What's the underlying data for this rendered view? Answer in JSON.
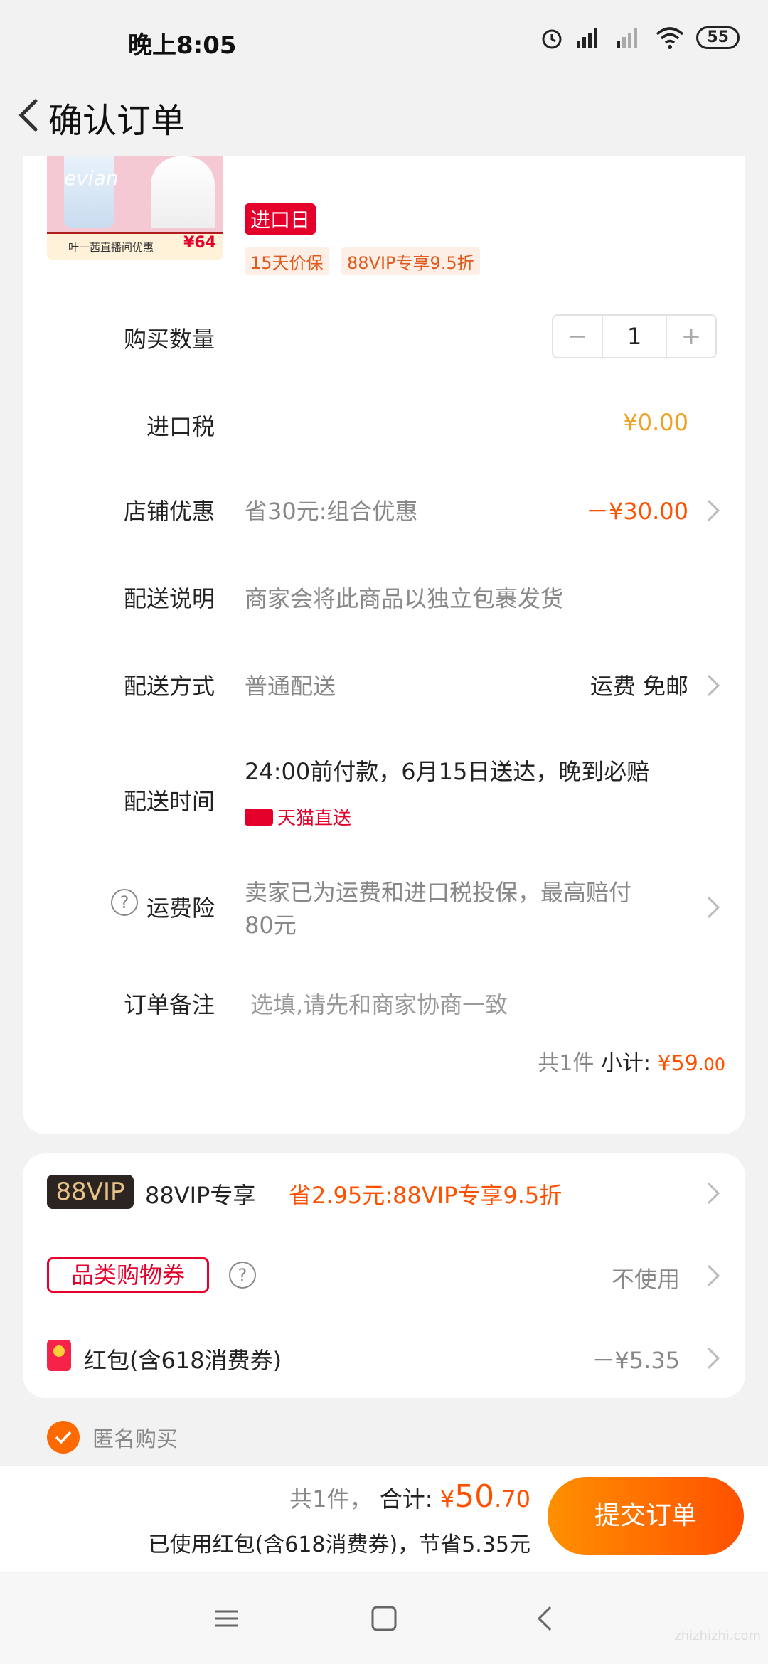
{
  "status_bar": {
    "time": "晚上8:05",
    "battery": "55"
  },
  "header": {
    "title": "确认订单"
  },
  "product": {
    "brand": "evian",
    "banner_text": "叶一茜直播间优惠",
    "banner_price": "¥64",
    "tags": {
      "import": "进口日",
      "price_protect": "15天价保",
      "vip": "88VIP专享9.5折"
    }
  },
  "order": {
    "quantity_label": "购买数量",
    "quantity": "1",
    "tax_label": "进口税",
    "tax_value": "¥0.00",
    "shop_discount_label": "店铺优惠",
    "shop_discount_desc": "省30元:组合优惠",
    "shop_discount_value": "－¥30.00",
    "delivery_note_label": "配送说明",
    "delivery_note_value": "商家会将此商品以独立包裹发货",
    "delivery_method_label": "配送方式",
    "delivery_method_value": "普通配送",
    "delivery_fee": "运费 免邮",
    "delivery_time_label": "配送时间",
    "delivery_time_value": "24:00前付款，6月15日送达，晚到必赔",
    "tmall_direct": "天猫直送",
    "insurance_label": "运费险",
    "insurance_line1": "卖家已为运费和进口税投保，最高赔付",
    "insurance_line2": "80元",
    "remark_label": "订单备注",
    "remark_placeholder": "选填,请先和商家协商一致",
    "subtotal_count": "共1件",
    "subtotal_label": "小计:",
    "subtotal_price": "¥59",
    "subtotal_decimal": ".00"
  },
  "promotions": {
    "vip_badge": "88VIP",
    "vip_label": "88VIP专享",
    "vip_desc": "省2.95元:88VIP专享9.5折",
    "coupon_badge": "品类购物券",
    "coupon_value": "不使用",
    "redpack_label": "红包(含618消费券)",
    "redpack_value": "－¥5.35"
  },
  "anonymous": {
    "label": "匿名购买",
    "checked": true
  },
  "bottom": {
    "count": "共1件，",
    "total_label": "合计:",
    "currency": "¥",
    "total_int": "50",
    "total_dec": ".70",
    "saving": "已使用红包(含618消费券)，节省5.35元",
    "submit": "提交订单"
  },
  "watermark": "zhizhizhi.com",
  "colors": {
    "accent": "#ff5000",
    "tmall_red": "#e4002b",
    "gold": "#f0a020"
  }
}
